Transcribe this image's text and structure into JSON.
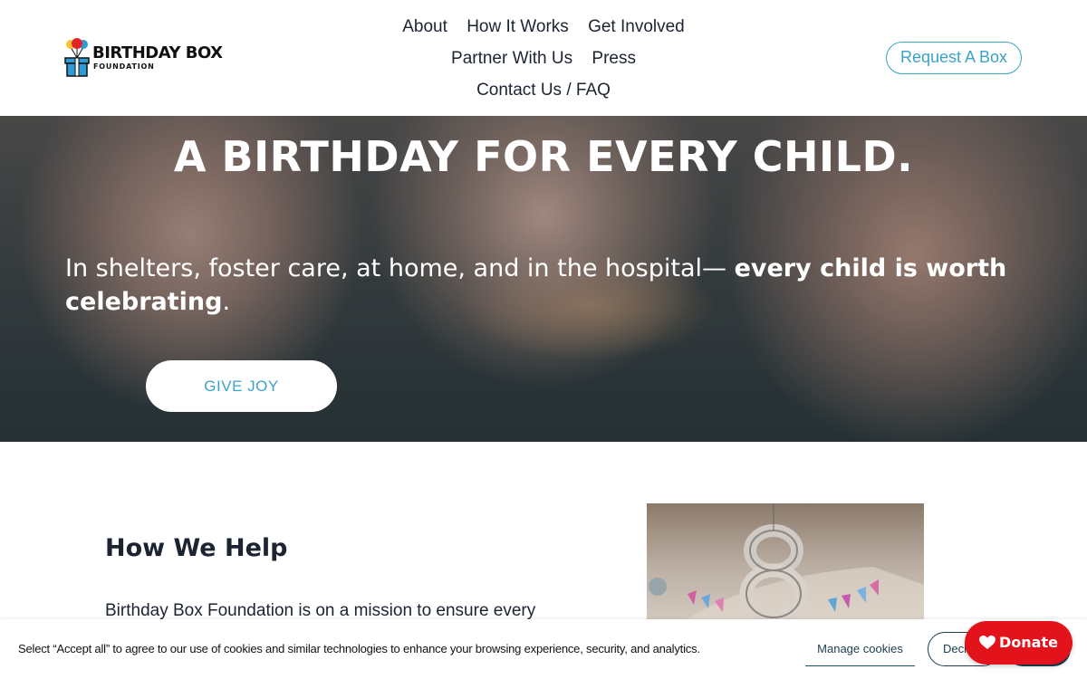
{
  "header": {
    "logo": {
      "line1": "BIRTHDAY BOX",
      "line2": "FOUNDATION"
    },
    "nav": {
      "row1": [
        "About",
        "How It Works",
        "Get Involved"
      ],
      "row2": [
        "Partner With Us",
        "Press"
      ],
      "row3": [
        "Contact Us / FAQ"
      ]
    },
    "request_button": "Request A Box"
  },
  "hero": {
    "title": "A BIRTHDAY FOR EVERY CHILD.",
    "subtitle_regular": "In shelters, foster care, at home, and in the hospital— ",
    "subtitle_bold": "every child is worth celebrating",
    "subtitle_end": ".",
    "cta": "GIVE JOY"
  },
  "help": {
    "title": "How We Help",
    "text": "Birthday Box Foundation is on a mission to ensure every"
  },
  "cookie": {
    "text": "Select “Accept all” to agree to our use of cookies and similar technologies to enhance your browsing experience, security, and analytics.",
    "manage": "Manage cookies",
    "decline": "Decli"
  },
  "donate": {
    "label": "Donate",
    "icon": "heart-icon"
  },
  "colors": {
    "accent": "#3aa3c8",
    "donate": "#e3131b",
    "text": "#1c2331",
    "cookie_button": "#1c3d4e"
  }
}
